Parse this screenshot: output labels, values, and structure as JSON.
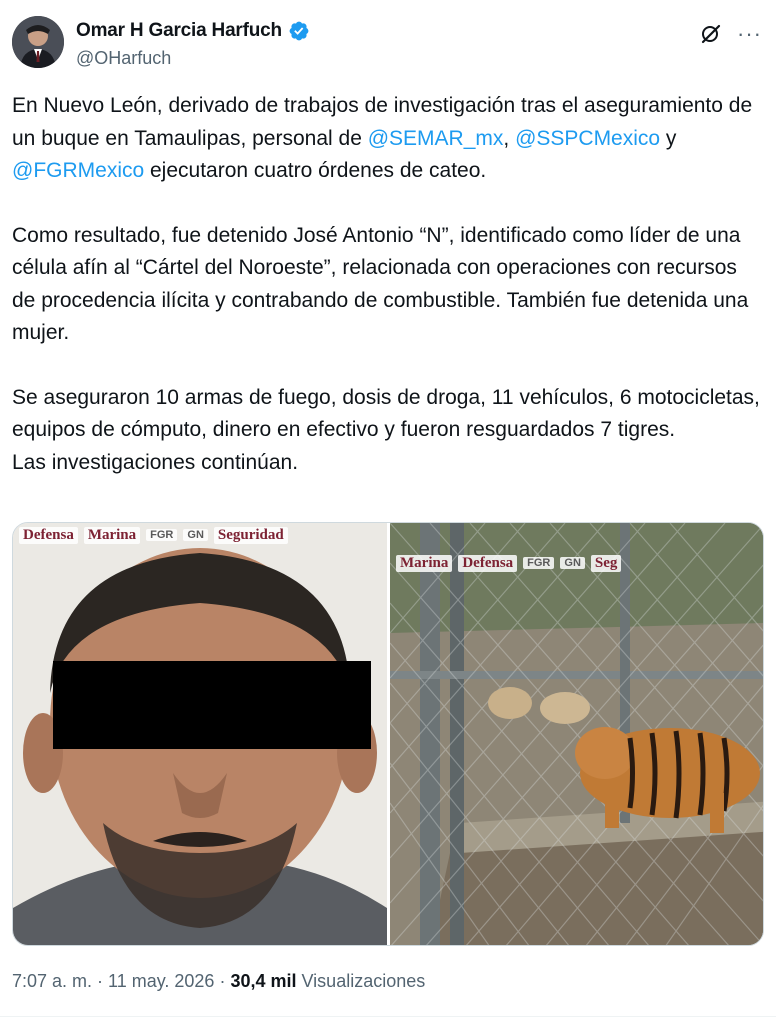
{
  "author": {
    "display_name": "Omar H Garcia Harfuch",
    "handle": "@OHarfuch",
    "verified": true,
    "avatar_icon": "profile-photo"
  },
  "header_icons": {
    "grok": "grok-icon",
    "more": "···"
  },
  "tweet": {
    "p1": [
      {
        "t": "En Nuevo León, derivado de trabajos de investigación tras el aseguramiento de un buque en Tamaulipas, personal  de "
      },
      {
        "t": "@SEMAR_mx",
        "m": true
      },
      {
        "t": ", "
      },
      {
        "t": "@SSPCMexico",
        "m": true
      },
      {
        "t": " y "
      },
      {
        "t": "@FGRMexico",
        "m": true
      },
      {
        "t": " ejecutaron cuatro órdenes de cateo."
      }
    ],
    "p2": "Como resultado, fue detenido José Antonio “N”, identificado como líder de una célula afín al “Cártel del Noroeste”, relacionada con operaciones con recursos de procedencia ilícita y contrabando de combustible. También fue detenida una mujer.",
    "p3": "Se aseguraron 10 armas de fuego, dosis de droga, 11 vehículos, 6 motocicletas, equipos de cómputo, dinero en efectivo y fueron resguardados 7 tigres.",
    "p4": "Las investigaciones continúan."
  },
  "media": {
    "left_logos": [
      "Defensa",
      "Marina",
      "FGR",
      "GN",
      "Seguridad"
    ],
    "right_logos": [
      "Marina",
      "Defensa",
      "FGR",
      "GN",
      "Seg"
    ]
  },
  "meta": {
    "time": "7:07 a. m.",
    "sep1": " · ",
    "date": "11 may. 2026",
    "sep2": " · ",
    "views": "30,4 mil",
    "views_label": " Visualizaciones"
  },
  "colors": {
    "mention": "#1d9bf0",
    "verified": "#1d9bf0",
    "secondary_text": "#536471"
  }
}
